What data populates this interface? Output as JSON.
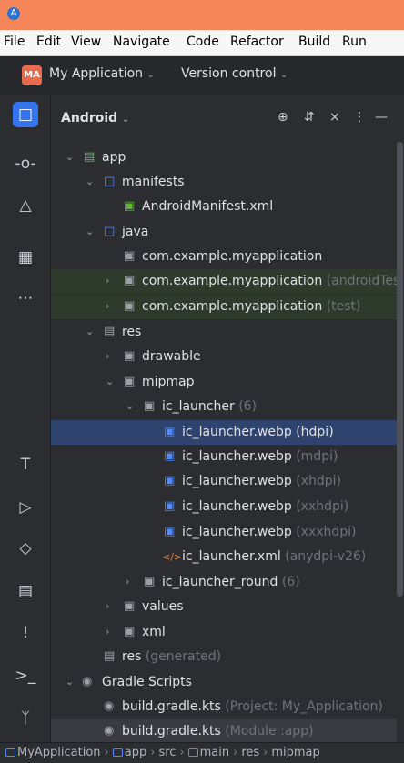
{
  "menubar": {
    "items": [
      "File",
      "Edit",
      "View",
      "Navigate",
      "Code",
      "Refactor",
      "Build",
      "Run"
    ]
  },
  "toolbar": {
    "project_badge": "MA",
    "project_name": "My Application",
    "vcs_label": "Version control"
  },
  "panel": {
    "title": "Android"
  },
  "tree": [
    {
      "label": "app",
      "suffix": ""
    },
    {
      "label": "manifests",
      "suffix": ""
    },
    {
      "label": "AndroidManifest.xml",
      "suffix": ""
    },
    {
      "label": "java",
      "suffix": ""
    },
    {
      "label": "com.example.myapplication",
      "suffix": ""
    },
    {
      "label": "com.example.myapplication",
      "suffix": "(androidTes"
    },
    {
      "label": "com.example.myapplication",
      "suffix": "(test)"
    },
    {
      "label": "res",
      "suffix": ""
    },
    {
      "label": "drawable",
      "suffix": ""
    },
    {
      "label": "mipmap",
      "suffix": ""
    },
    {
      "label": "ic_launcher",
      "suffix": "(6)"
    },
    {
      "label": "ic_launcher.webp (hdpi)",
      "suffix": ""
    },
    {
      "label": "ic_launcher.webp",
      "suffix": "(mdpi)"
    },
    {
      "label": "ic_launcher.webp",
      "suffix": "(xhdpi)"
    },
    {
      "label": "ic_launcher.webp",
      "suffix": "(xxhdpi)"
    },
    {
      "label": "ic_launcher.webp",
      "suffix": "(xxxhdpi)"
    },
    {
      "label": "ic_launcher.xml",
      "suffix": "(anydpi-v26)"
    },
    {
      "label": "ic_launcher_round",
      "suffix": "(6)"
    },
    {
      "label": "values",
      "suffix": ""
    },
    {
      "label": "xml",
      "suffix": ""
    },
    {
      "label": "res",
      "suffix": "(generated)"
    },
    {
      "label": "Gradle Scripts",
      "suffix": ""
    },
    {
      "label": "build.gradle.kts",
      "suffix": "(Project: My_Application)"
    },
    {
      "label": "build.gradle.kts",
      "suffix": "(Module :app)"
    }
  ],
  "breadcrumb": [
    "MyApplication",
    "app",
    "src",
    "main",
    "res",
    "mipmap"
  ]
}
